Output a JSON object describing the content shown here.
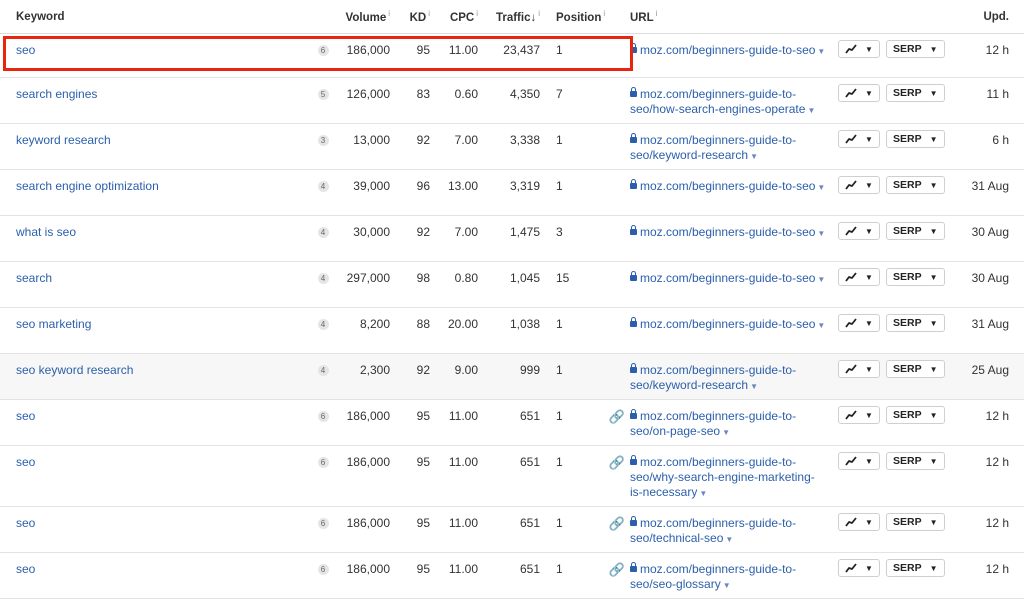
{
  "columns": {
    "keyword": "Keyword",
    "volume": "Volume",
    "kd": "KD",
    "cpc": "CPC",
    "traffic": "Traffic",
    "position": "Position",
    "url": "URL",
    "updated": "Upd."
  },
  "info_mark": "i",
  "sort_arrow": "↓",
  "serp_label": "SERP",
  "rows": [
    {
      "keyword": "seo",
      "count": "6",
      "volume": "186,000",
      "kd": "95",
      "cpc": "11.00",
      "traffic": "23,437",
      "position": "1",
      "link_icon": "",
      "url_line1": "moz.com/beginners-guide-to-seo",
      "url_line2": "",
      "url_line3": "",
      "updated": "12 h"
    },
    {
      "keyword": "search engines",
      "count": "5",
      "volume": "126,000",
      "kd": "83",
      "cpc": "0.60",
      "traffic": "4,350",
      "position": "7",
      "link_icon": "",
      "url_line1": "moz.com/beginners-guide-to-",
      "url_line2": "seo/how-search-engines-operate",
      "url_line3": "",
      "updated": "11 h"
    },
    {
      "keyword": "keyword research",
      "count": "3",
      "volume": "13,000",
      "kd": "92",
      "cpc": "7.00",
      "traffic": "3,338",
      "position": "1",
      "link_icon": "",
      "url_line1": "moz.com/beginners-guide-to-",
      "url_line2": "seo/keyword-research",
      "url_line3": "",
      "updated": "6 h"
    },
    {
      "keyword": "search engine optimization",
      "count": "4",
      "volume": "39,000",
      "kd": "96",
      "cpc": "13.00",
      "traffic": "3,319",
      "position": "1",
      "link_icon": "",
      "url_line1": "moz.com/beginners-guide-to-seo",
      "url_line2": "",
      "url_line3": "",
      "updated": "31 Aug"
    },
    {
      "keyword": "what is seo",
      "count": "4",
      "volume": "30,000",
      "kd": "92",
      "cpc": "7.00",
      "traffic": "1,475",
      "position": "3",
      "link_icon": "",
      "url_line1": "moz.com/beginners-guide-to-seo",
      "url_line2": "",
      "url_line3": "",
      "updated": "30 Aug"
    },
    {
      "keyword": "search",
      "count": "4",
      "volume": "297,000",
      "kd": "98",
      "cpc": "0.80",
      "traffic": "1,045",
      "position": "15",
      "link_icon": "",
      "url_line1": "moz.com/beginners-guide-to-seo",
      "url_line2": "",
      "url_line3": "",
      "updated": "30 Aug"
    },
    {
      "keyword": "seo marketing",
      "count": "4",
      "volume": "8,200",
      "kd": "88",
      "cpc": "20.00",
      "traffic": "1,038",
      "position": "1",
      "link_icon": "",
      "url_line1": "moz.com/beginners-guide-to-seo",
      "url_line2": "",
      "url_line3": "",
      "updated": "31 Aug"
    },
    {
      "keyword": "seo keyword research",
      "count": "4",
      "volume": "2,300",
      "kd": "92",
      "cpc": "9.00",
      "traffic": "999",
      "position": "1",
      "link_icon": "",
      "url_line1": "moz.com/beginners-guide-to-",
      "url_line2": "seo/keyword-research",
      "url_line3": "",
      "updated": "25 Aug",
      "highlight": true
    },
    {
      "keyword": "seo",
      "count": "6",
      "volume": "186,000",
      "kd": "95",
      "cpc": "11.00",
      "traffic": "651",
      "position": "1",
      "link_icon": "🔗",
      "url_line1": "moz.com/beginners-guide-to-",
      "url_line2": "seo/on-page-seo",
      "url_line3": "",
      "updated": "12 h"
    },
    {
      "keyword": "seo",
      "count": "6",
      "volume": "186,000",
      "kd": "95",
      "cpc": "11.00",
      "traffic": "651",
      "position": "1",
      "link_icon": "🔗",
      "url_line1": "moz.com/beginners-guide-to-",
      "url_line2": "seo/why-search-engine-marketing-",
      "url_line3": "is-necessary",
      "updated": "12 h"
    },
    {
      "keyword": "seo",
      "count": "6",
      "volume": "186,000",
      "kd": "95",
      "cpc": "11.00",
      "traffic": "651",
      "position": "1",
      "link_icon": "🔗",
      "url_line1": "moz.com/beginners-guide-to-",
      "url_line2": "seo/technical-seo",
      "url_line3": "",
      "updated": "12 h"
    },
    {
      "keyword": "seo",
      "count": "6",
      "volume": "186,000",
      "kd": "95",
      "cpc": "11.00",
      "traffic": "651",
      "position": "1",
      "link_icon": "🔗",
      "url_line1": "moz.com/beginners-guide-to-",
      "url_line2": "seo/seo-glossary",
      "url_line3": "",
      "updated": "12 h"
    }
  ],
  "colors": {
    "link": "#2b5fab",
    "highlight_box": "#e8260f",
    "row_highlight": "#f7f7f7"
  },
  "icons": {
    "lock": "lock-icon",
    "chain": "link-icon",
    "trend": "trend-chart-icon",
    "dropdown": "chevron-down-icon"
  }
}
